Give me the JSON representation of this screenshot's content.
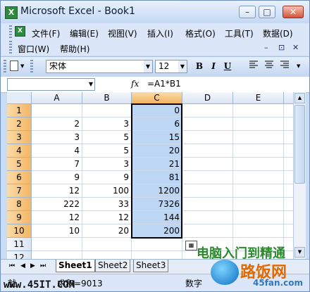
{
  "window": {
    "title": "Microsoft Excel - Book1",
    "app_icon": "X"
  },
  "window_buttons": {
    "minimize": "–",
    "restore": "□",
    "close": "✕"
  },
  "menus": [
    {
      "label": "文件(F)"
    },
    {
      "label": "编辑(E)"
    },
    {
      "label": "视图(V)"
    },
    {
      "label": "插入(I)"
    },
    {
      "label": "格式(O)"
    },
    {
      "label": "工具(T)"
    },
    {
      "label": "数据(D)"
    },
    {
      "label": "窗口(W)"
    },
    {
      "label": "帮助(H)"
    }
  ],
  "doc_controls": {
    "minimize": "–",
    "restore": "⊡",
    "close": "✕"
  },
  "toolbar": {
    "font_name": "宋体",
    "font_size": "12",
    "bold": "B",
    "italic": "I",
    "underline": "U"
  },
  "formula_bar": {
    "name_box": "",
    "fx": "fx",
    "formula": "=A1*B1"
  },
  "columns": [
    "A",
    "B",
    "C",
    "D",
    "E"
  ],
  "rows": [
    {
      "num": "1",
      "A": "",
      "B": "",
      "C": "0"
    },
    {
      "num": "2",
      "A": "2",
      "B": "3",
      "C": "6"
    },
    {
      "num": "3",
      "A": "3",
      "B": "5",
      "C": "15"
    },
    {
      "num": "4",
      "A": "4",
      "B": "5",
      "C": "20"
    },
    {
      "num": "5",
      "A": "7",
      "B": "3",
      "C": "21"
    },
    {
      "num": "6",
      "A": "9",
      "B": "9",
      "C": "81"
    },
    {
      "num": "7",
      "A": "12",
      "B": "100",
      "C": "1200"
    },
    {
      "num": "8",
      "A": "222",
      "B": "33",
      "C": "7326"
    },
    {
      "num": "9",
      "A": "12",
      "B": "12",
      "C": "144"
    },
    {
      "num": "10",
      "A": "10",
      "B": "20",
      "C": "200"
    },
    {
      "num": "11",
      "A": "",
      "B": "",
      "C": ""
    },
    {
      "num": "12",
      "A": "",
      "B": "",
      "C": ""
    }
  ],
  "selection": {
    "column": "C",
    "rows": "1-10"
  },
  "sheet_nav": [
    "⏮",
    "◀",
    "▶",
    "⏭"
  ],
  "sheets": [
    {
      "name": "Sheet1",
      "active": true
    },
    {
      "name": "Sheet2"
    },
    {
      "name": "Sheet3"
    }
  ],
  "status": {
    "left": "就",
    "sum": "求和=9013",
    "mode": "数字"
  },
  "watermarks": {
    "site_left": "www.45IT.COM",
    "cn_text": "电脑入门到精通",
    "logo_text": "路饭网",
    "logo_url": "45fan.com"
  },
  "colors": {
    "selection": "#bcd6f3",
    "header_selected": "#f2b35c",
    "accent": "#2d8a3e"
  }
}
